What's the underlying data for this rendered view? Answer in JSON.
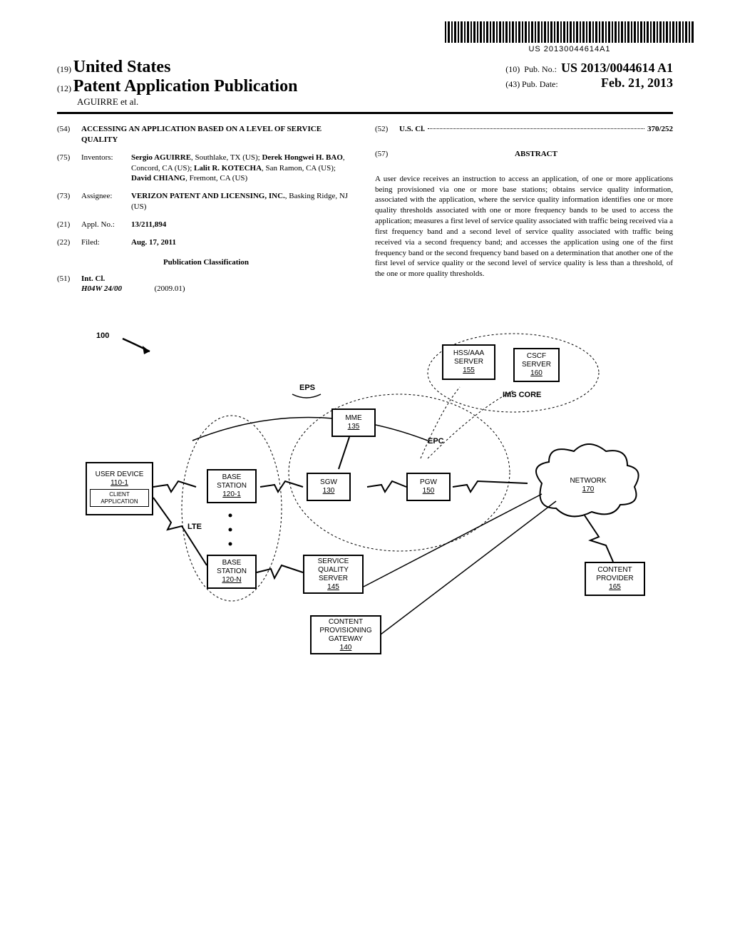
{
  "barcode_text": "US 20130044614A1",
  "header": {
    "code19": "(19)",
    "country": "United States",
    "code12": "(12)",
    "doc_type": "Patent Application Publication",
    "authors_line": "AGUIRRE et al.",
    "code10": "(10)",
    "pub_no_label": "Pub. No.:",
    "pub_no_value": "US 2013/0044614 A1",
    "code43": "(43)",
    "pub_date_label": "Pub. Date:",
    "pub_date_value": "Feb. 21, 2013"
  },
  "fields": {
    "title": {
      "code": "(54)",
      "value": "ACCESSING AN APPLICATION BASED ON A LEVEL OF SERVICE QUALITY"
    },
    "inventors": {
      "code": "(75)",
      "label": "Inventors:",
      "value_html_parts": [
        "Sergio AGUIRRE",
        ", Southlake, TX (US); ",
        "Derek Hongwei H. BAO",
        ", Concord, CA (US); ",
        "Lalit R. KOTECHA",
        ", San Ramon, CA (US); ",
        "David CHIANG",
        ", Fremont, CA (US)"
      ],
      "value_plain": "Sergio AGUIRRE, Southlake, TX (US); Derek Hongwei H. BAO, Concord, CA (US); Lalit R. KOTECHA, San Ramon, CA (US); David CHIANG, Fremont, CA (US)"
    },
    "assignee": {
      "code": "(73)",
      "label": "Assignee:",
      "name": "VERIZON PATENT AND LICENSING, INC.",
      "loc": ", Basking Ridge, NJ (US)"
    },
    "appl_no": {
      "code": "(21)",
      "label": "Appl. No.:",
      "value": "13/211,894"
    },
    "filed": {
      "code": "(22)",
      "label": "Filed:",
      "value": "Aug. 17, 2011"
    },
    "pub_class": "Publication Classification",
    "int_cl": {
      "code": "(51)",
      "label": "Int. Cl.",
      "class": "H04W 24/00",
      "edition": "(2009.01)"
    },
    "us_cl": {
      "code": "(52)",
      "label": "U.S. Cl.",
      "value": "370/252"
    },
    "abstract_code": "(57)",
    "abstract_label": "ABSTRACT",
    "abstract_text": "A user device receives an instruction to access an application, of one or more applications being provisioned via one or more base stations; obtains service quality information, associated with the application, where the service quality information identifies one or more quality thresholds associated with one or more frequency bands to be used to access the application; measures a first level of service quality associated with traffic being received via a first frequency band and a second level of service quality associated with traffic being received via a second frequency band; and accesses the application using one of the first frequency band or the second frequency band based on a determination that another one of the first level of service quality or the second level of service quality is less than a threshold, of the one or more quality thresholds."
  },
  "figure": {
    "ref": "100",
    "labels": {
      "eps": "EPS",
      "lte": "LTE",
      "epc": "EPC",
      "ims": "IMS CORE"
    },
    "boxes": {
      "user_device": {
        "title": "USER DEVICE",
        "ref": "110-1",
        "inner": "CLIENT APPLICATION"
      },
      "base1": {
        "title": "BASE STATION",
        "ref": "120-1"
      },
      "baseN": {
        "title": "BASE STATION",
        "ref": "120-N"
      },
      "sgw": {
        "title": "SGW",
        "ref": "130"
      },
      "mme": {
        "title": "MME",
        "ref": "135"
      },
      "cpg": {
        "title": "CONTENT PROVISIONING GATEWAY",
        "ref": "140"
      },
      "sqs": {
        "title": "SERVICE QUALITY SERVER",
        "ref": "145"
      },
      "pgw": {
        "title": "PGW",
        "ref": "150"
      },
      "hss": {
        "title": "HSS/AAA SERVER",
        "ref": "155"
      },
      "cscf": {
        "title": "CSCF SERVER",
        "ref": "160"
      },
      "cp": {
        "title": "CONTENT PROVIDER",
        "ref": "165"
      },
      "network": {
        "title": "NETWORK",
        "ref": "170"
      }
    }
  }
}
